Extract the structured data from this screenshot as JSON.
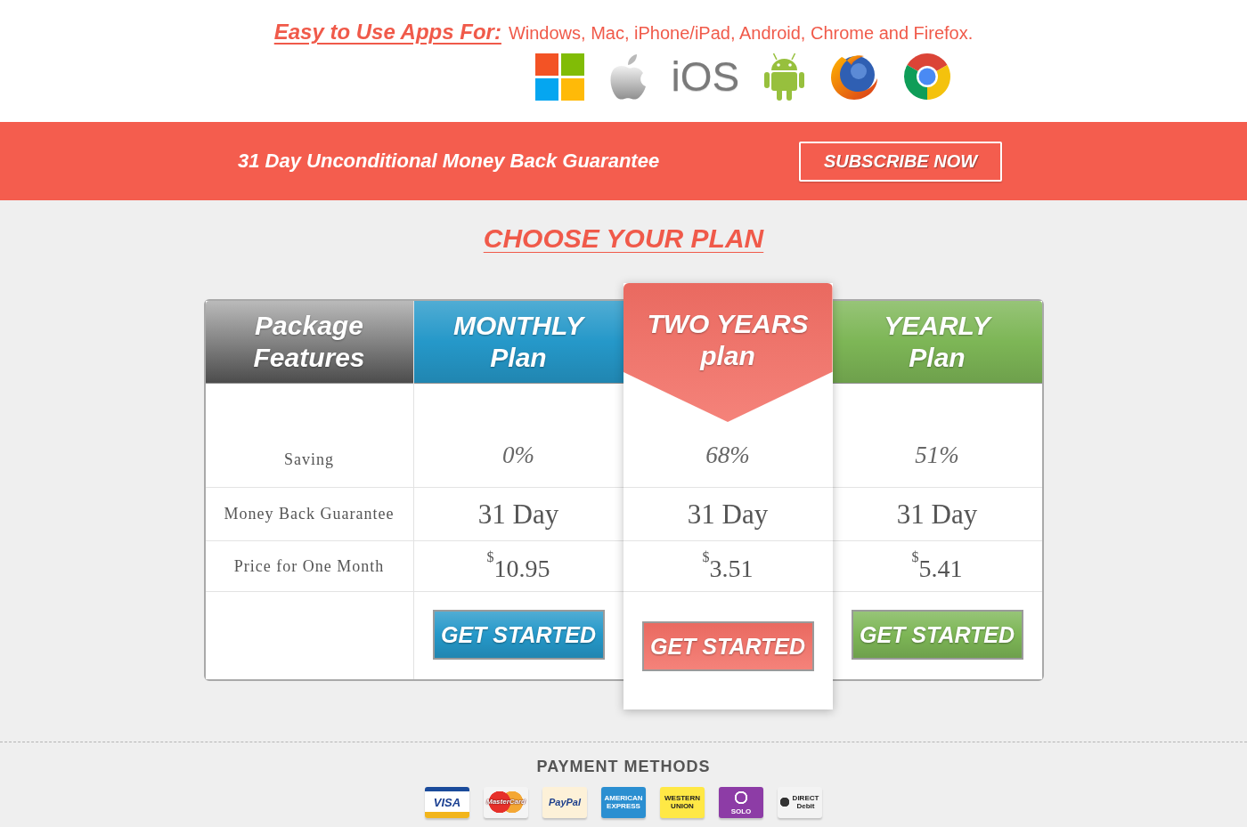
{
  "header": {
    "lead": "Easy to Use Apps For:",
    "platforms": "Windows, Mac, iPhone/iPad, Android, Chrome and Firefox.",
    "ios_logo": "iOS"
  },
  "banner": {
    "text": "31 Day Unconditional Money Back Guarantee",
    "button": "SUBSCRIBE NOW"
  },
  "pricing": {
    "title": "CHOOSE YOUR PLAN",
    "features": {
      "heading": "Package Features",
      "rows": [
        "Saving",
        "Money Back Guarantee",
        "Price for One Month"
      ]
    },
    "plans": [
      {
        "name": "MONTHLY",
        "subtitle": "Plan",
        "color": "#2598c9",
        "featured": false,
        "saving": "0%",
        "guarantee": "31 Day",
        "currency": "$",
        "price": "10.95",
        "button": "GET STARTED"
      },
      {
        "name": "TWO YEARS",
        "subtitle": "plan",
        "color": "#f36e64",
        "featured": true,
        "saving": "68%",
        "guarantee": "31 Day",
        "currency": "$",
        "price": "3.51",
        "button": "GET STARTED"
      },
      {
        "name": "YEARLY",
        "subtitle": "Plan",
        "color": "#7db656",
        "featured": false,
        "saving": "51%",
        "guarantee": "31 Day",
        "currency": "$",
        "price": "5.41",
        "button": "GET STARTED"
      }
    ]
  },
  "payment_methods": {
    "title": "PAYMENT METHODS",
    "cards": [
      {
        "kind": "visa",
        "label": "VISA"
      },
      {
        "kind": "mastercard",
        "label": "MasterCard"
      },
      {
        "kind": "paypal",
        "label": "PayPal"
      },
      {
        "kind": "amex",
        "label": "AMERICAN EXPRESS"
      },
      {
        "kind": "westernunion",
        "label": "WESTERN UNION"
      },
      {
        "kind": "solo",
        "label": "SOLO"
      },
      {
        "kind": "directdebit",
        "label": "DIRECT Debit"
      }
    ]
  }
}
